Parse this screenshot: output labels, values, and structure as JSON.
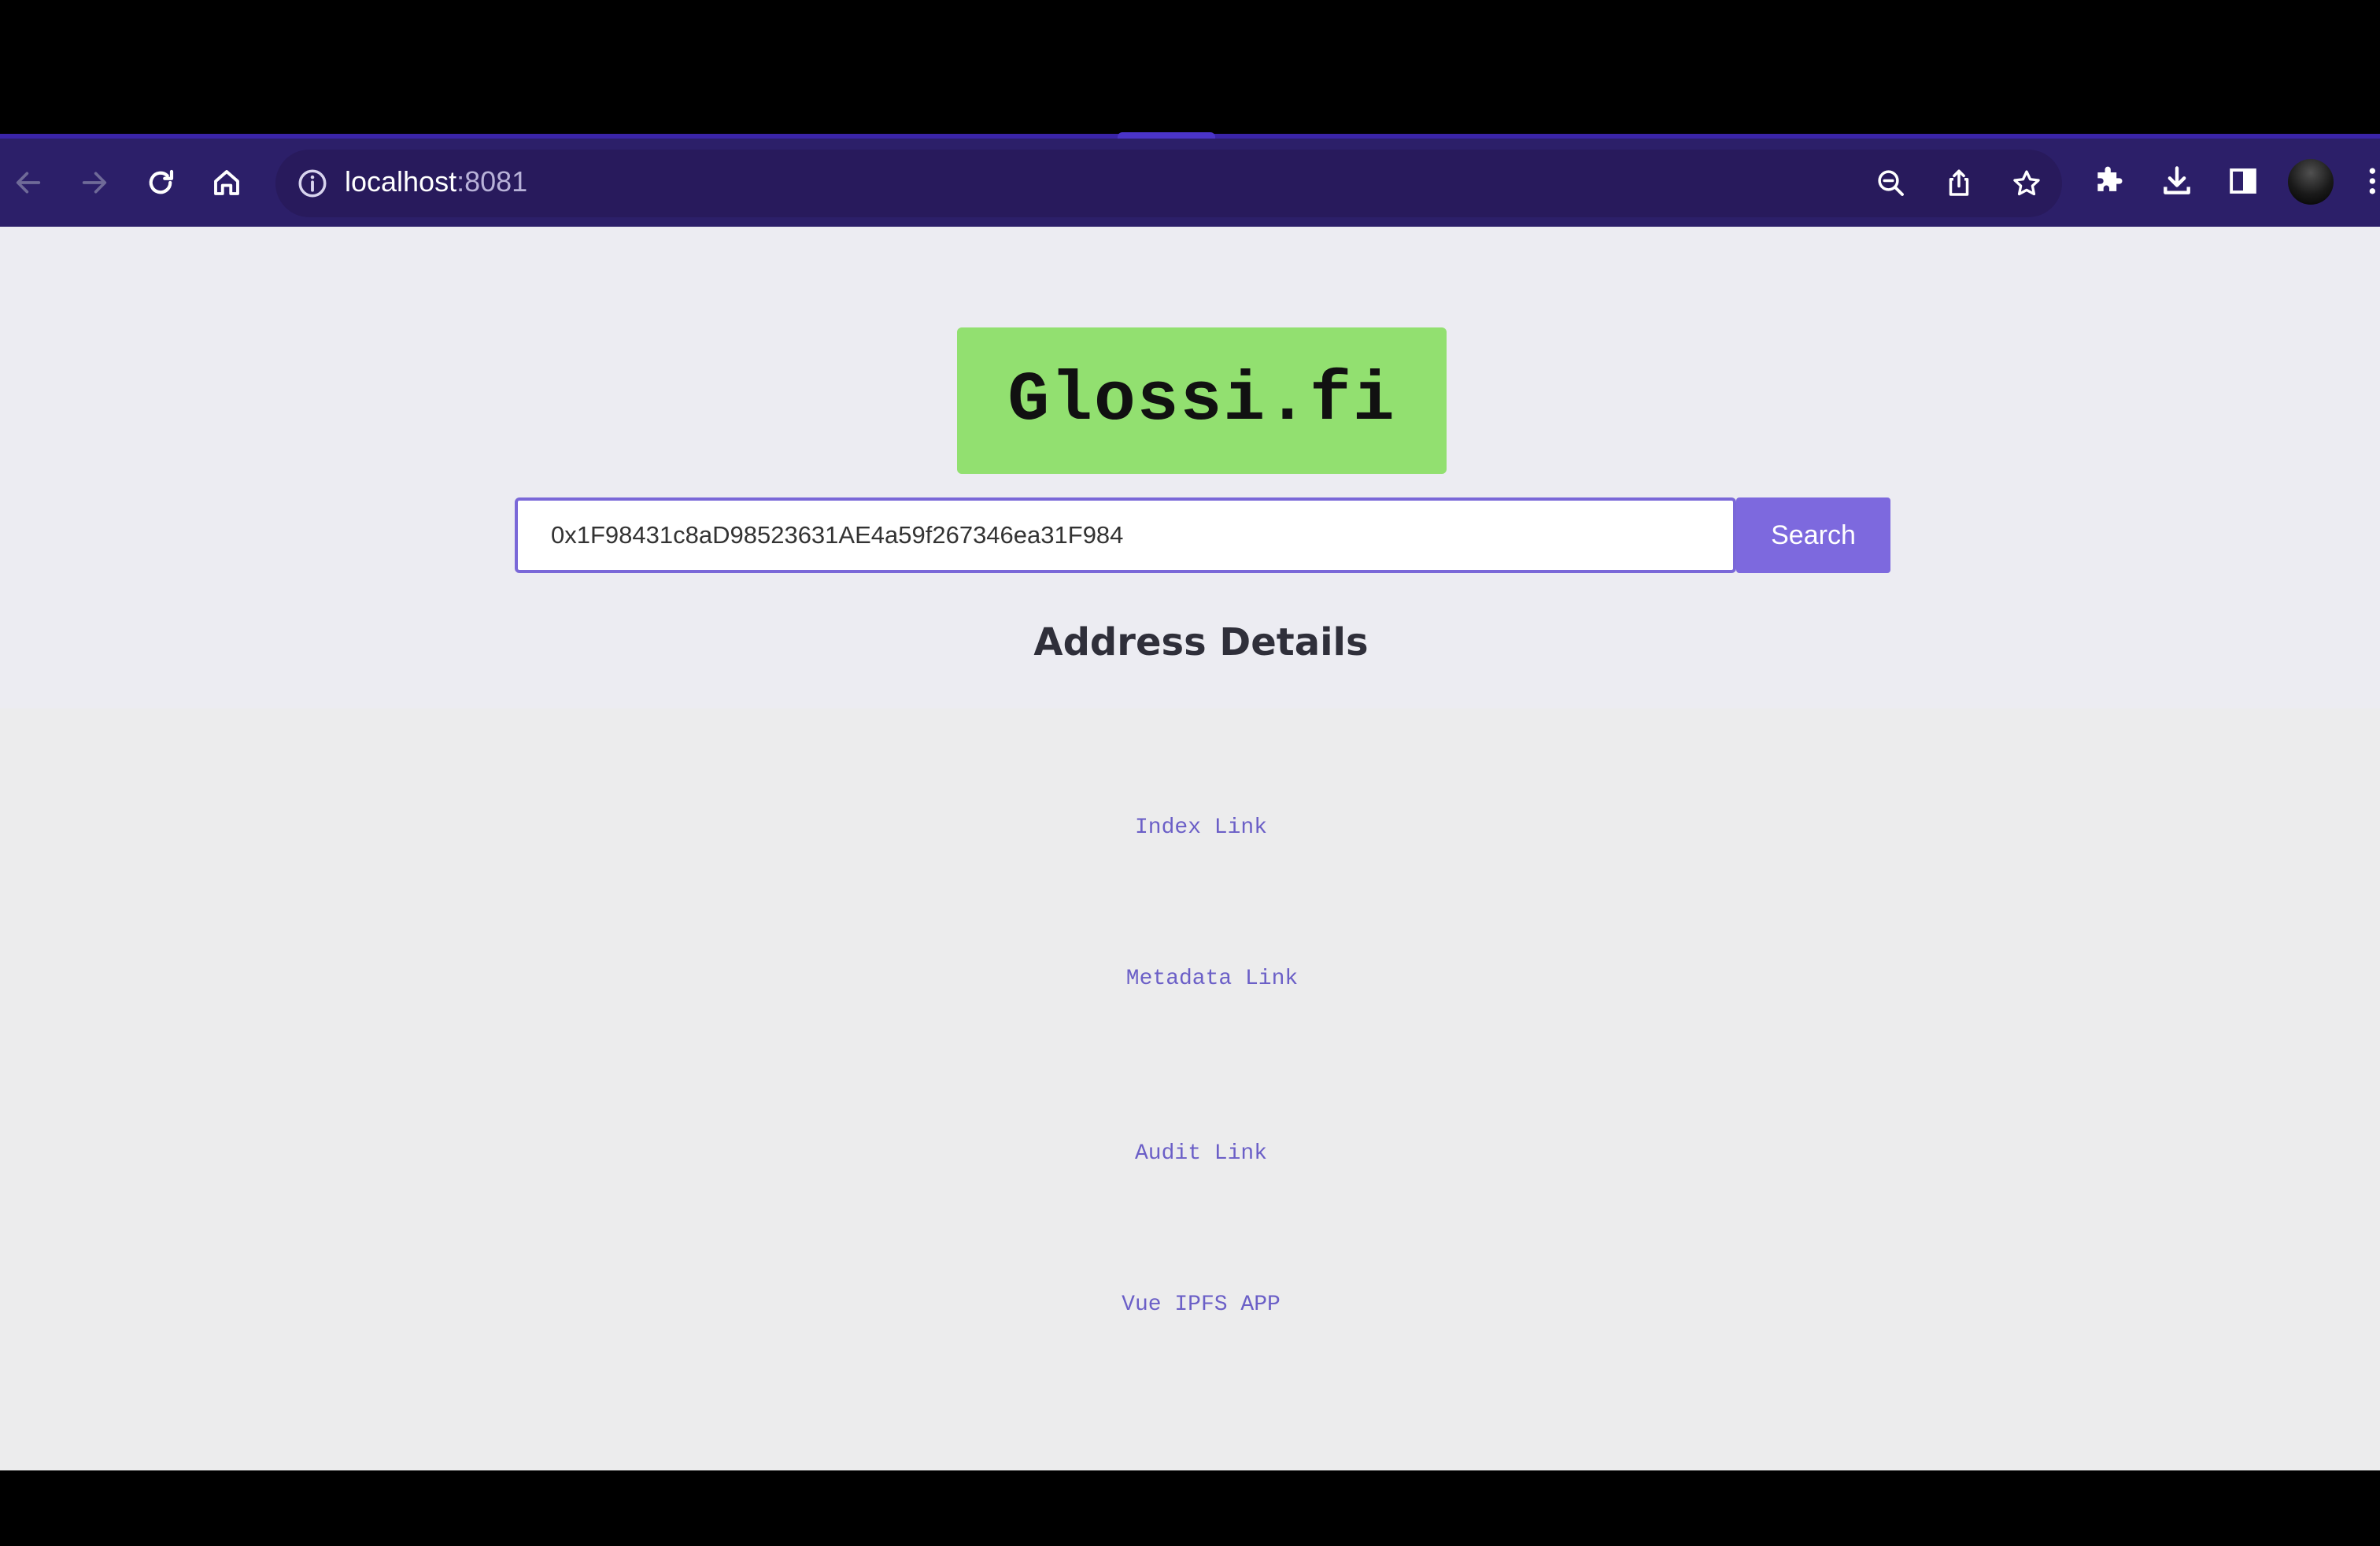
{
  "browser": {
    "url_host": "localhost",
    "url_port": ":8081",
    "icons": {
      "back": "arrow-left-icon",
      "forward": "arrow-right-icon",
      "reload": "reload-icon",
      "home": "home-icon",
      "site_info": "info-icon",
      "zoom": "zoom-out-icon",
      "share": "share-icon",
      "bookmark": "star-icon",
      "extensions": "puzzle-icon",
      "downloads": "download-icon",
      "side_panel": "side-panel-icon",
      "profile": "avatar",
      "menu": "kebab-menu-icon"
    },
    "colors": {
      "toolbar": "#2c1f69",
      "omnibox": "#281a5c"
    }
  },
  "app": {
    "logo_text": "Glossi.fi",
    "logo_color": "#92e070",
    "search": {
      "value": "0x1F98431c8aD98523631AE4a59f267346ea31F984",
      "button_label": "Search",
      "accent_color": "#7d69de"
    },
    "section_title": "Address Details",
    "links": [
      {
        "label": "Index Link"
      },
      {
        "label": "Metadata Link"
      },
      {
        "label": "Audit Link"
      },
      {
        "label": "Vue IPFS APP"
      }
    ]
  }
}
